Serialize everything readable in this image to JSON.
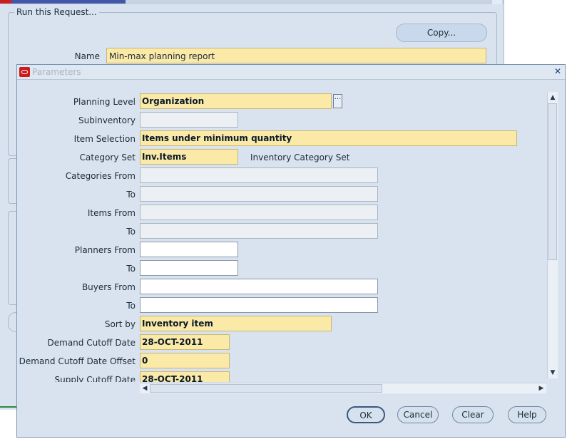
{
  "background_window": {
    "group_legend": "Run this Request...",
    "copy_button": "Copy...",
    "name_label": "Name",
    "name_value": "Min-max planning report"
  },
  "dialog": {
    "title": "Parameters",
    "close_icon": "close-icon",
    "logo_icon": "oracle-logo-icon"
  },
  "params": {
    "planning_level": {
      "label": "Planning Level",
      "value": "Organization"
    },
    "subinventory": {
      "label": "Subinventory",
      "value": ""
    },
    "item_selection": {
      "label": "Item Selection",
      "value": "Items under minimum quantity"
    },
    "category_set": {
      "label": "Category Set",
      "value": "Inv.Items",
      "description": "Inventory Category Set"
    },
    "categories_from": {
      "label": "Categories From",
      "value": ""
    },
    "categories_to": {
      "label": "To",
      "value": ""
    },
    "items_from": {
      "label": "Items From",
      "value": ""
    },
    "items_to": {
      "label": "To",
      "value": ""
    },
    "planners_from": {
      "label": "Planners From",
      "value": ""
    },
    "planners_to": {
      "label": "To",
      "value": ""
    },
    "buyers_from": {
      "label": "Buyers From",
      "value": ""
    },
    "buyers_to": {
      "label": "To",
      "value": ""
    },
    "sort_by": {
      "label": "Sort by",
      "value": "Inventory item"
    },
    "demand_cutoff_date": {
      "label": "Demand Cutoff Date",
      "value": "28-OCT-2011"
    },
    "demand_cutoff_offset": {
      "label": "Demand Cutoff Date Offset",
      "value": "0"
    },
    "supply_cutoff_date": {
      "label": "Supply Cutoff Date",
      "value": "28-OCT-2011"
    }
  },
  "buttons": {
    "ok": "OK",
    "cancel": "Cancel",
    "clear": "Clear",
    "help": "Help"
  },
  "colors": {
    "required_field": "#fbe9a8",
    "dialog_bg": "#d9e3ef",
    "brand_red": "#d01a1a"
  }
}
